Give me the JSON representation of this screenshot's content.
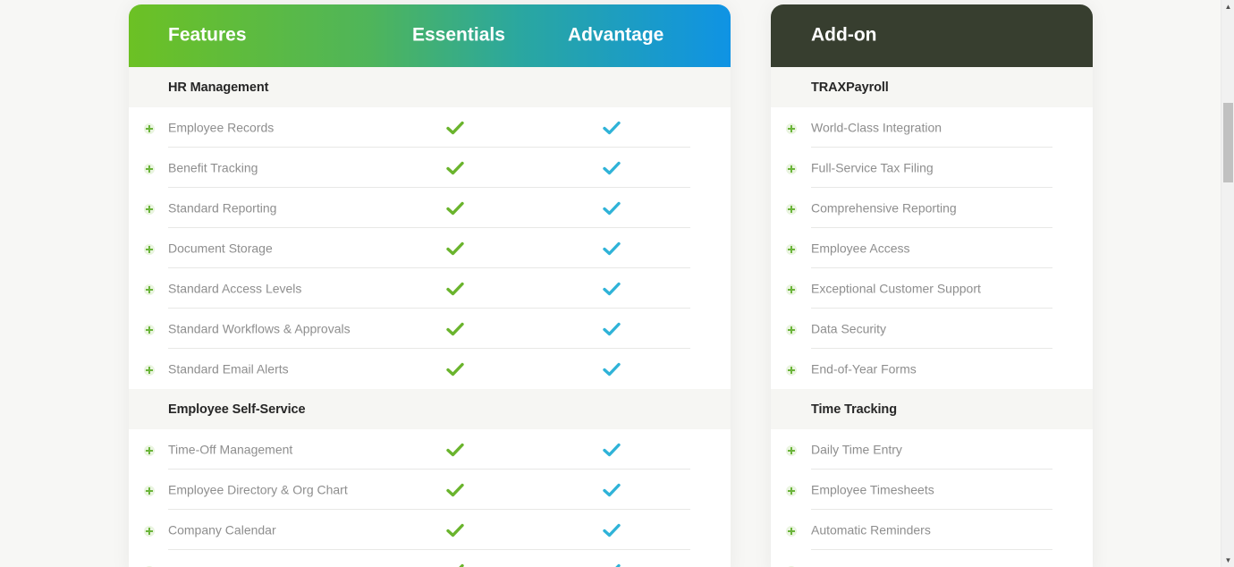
{
  "features_table": {
    "header": {
      "features": "Features",
      "essentials": "Essentials",
      "advantage": "Advantage"
    },
    "colors": {
      "gradient_start": "#6cc124",
      "gradient_end": "#0f93e4",
      "check_essentials": "#6ab42d",
      "check_advantage": "#2fb3d8"
    },
    "sections": [
      {
        "title": "HR Management",
        "rows": [
          {
            "label": "Employee Records",
            "essentials": true,
            "advantage": true
          },
          {
            "label": "Benefit Tracking",
            "essentials": true,
            "advantage": true
          },
          {
            "label": "Standard Reporting",
            "essentials": true,
            "advantage": true
          },
          {
            "label": "Document Storage",
            "essentials": true,
            "advantage": true
          },
          {
            "label": "Standard Access Levels",
            "essentials": true,
            "advantage": true
          },
          {
            "label": "Standard Workflows & Approvals",
            "essentials": true,
            "advantage": true
          },
          {
            "label": "Standard Email Alerts",
            "essentials": true,
            "advantage": true
          }
        ]
      },
      {
        "title": "Employee Self-Service",
        "rows": [
          {
            "label": "Time-Off Management",
            "essentials": true,
            "advantage": true
          },
          {
            "label": "Employee Directory & Org Chart",
            "essentials": true,
            "advantage": true
          },
          {
            "label": "Company Calendar",
            "essentials": true,
            "advantage": true
          },
          {
            "label": "",
            "essentials": true,
            "advantage": true
          }
        ]
      }
    ]
  },
  "addon_table": {
    "header": {
      "title": "Add-on"
    },
    "colors": {
      "header_bg": "#373e2f"
    },
    "sections": [
      {
        "title": "TRAXPayroll",
        "rows": [
          {
            "label": "World-Class Integration"
          },
          {
            "label": "Full-Service Tax Filing"
          },
          {
            "label": "Comprehensive Reporting"
          },
          {
            "label": "Employee Access"
          },
          {
            "label": "Exceptional Customer Support"
          },
          {
            "label": "Data Security"
          },
          {
            "label": "End-of-Year Forms"
          }
        ]
      },
      {
        "title": "Time Tracking",
        "rows": [
          {
            "label": "Daily Time Entry"
          },
          {
            "label": "Employee Timesheets"
          },
          {
            "label": "Automatic Reminders"
          },
          {
            "label": ""
          }
        ]
      }
    ]
  },
  "scrollbar": {
    "up_icon": "▲",
    "down_icon": "▼"
  }
}
